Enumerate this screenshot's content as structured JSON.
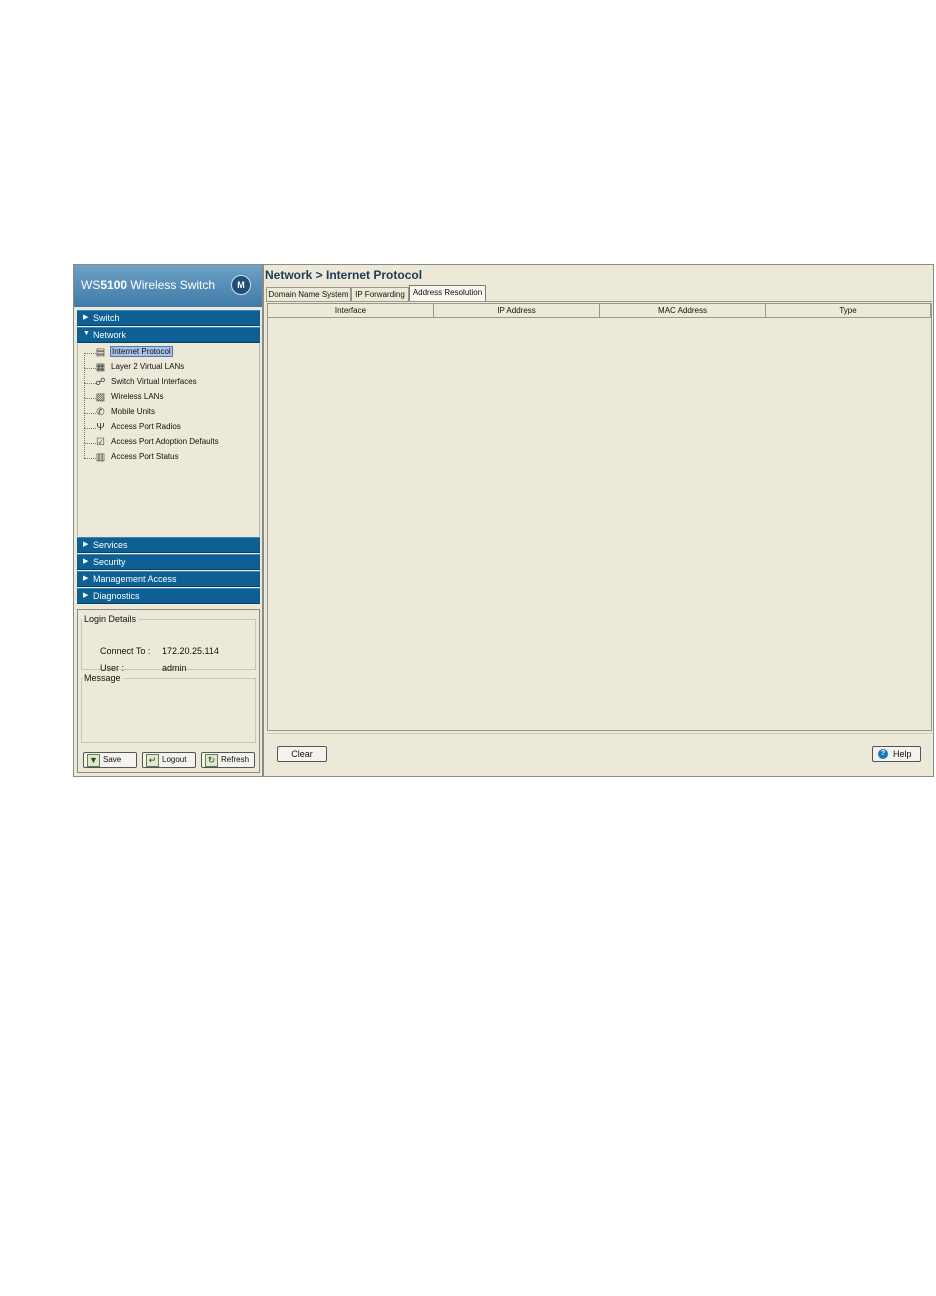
{
  "app": {
    "brand_prefix": "WS",
    "brand_model": "5100",
    "brand_suffix": " Wireless Switch",
    "logo_glyph": "M"
  },
  "nav": {
    "switch": "Switch",
    "network": "Network",
    "services": "Services",
    "security": "Security",
    "management": "Management Access",
    "diagnostics": "Diagnostics"
  },
  "tree": {
    "items": [
      {
        "label": "Internet Protocol",
        "icon": "ip-icon",
        "selected": true
      },
      {
        "label": "Layer 2 Virtual LANs",
        "icon": "vlan-icon"
      },
      {
        "label": "Switch Virtual Interfaces",
        "icon": "svi-icon"
      },
      {
        "label": "Wireless LANs",
        "icon": "wlan-icon"
      },
      {
        "label": "Mobile Units",
        "icon": "mobile-unit-icon"
      },
      {
        "label": "Access Port Radios",
        "icon": "antenna-icon"
      },
      {
        "label": "Access Port Adoption Defaults",
        "icon": "adoption-icon"
      },
      {
        "label": "Access Port Status",
        "icon": "status-icon"
      }
    ]
  },
  "login": {
    "legend": "Login Details",
    "connect_label": "Connect To :",
    "connect_value": "172.20.25.114",
    "user_label": "User :",
    "user_value": "admin"
  },
  "message": {
    "legend": "Message"
  },
  "buttons": {
    "save": "Save",
    "logout": "Logout",
    "refresh": "Refresh"
  },
  "main": {
    "breadcrumb": "Network > Internet Protocol",
    "tabs": [
      "Domain Name System",
      "IP Forwarding",
      "Address Resolution"
    ],
    "active_tab": "Address Resolution",
    "columns": [
      "Interface",
      "IP Address",
      "MAC Address",
      "Type"
    ],
    "clear": "Clear",
    "help": "Help"
  }
}
